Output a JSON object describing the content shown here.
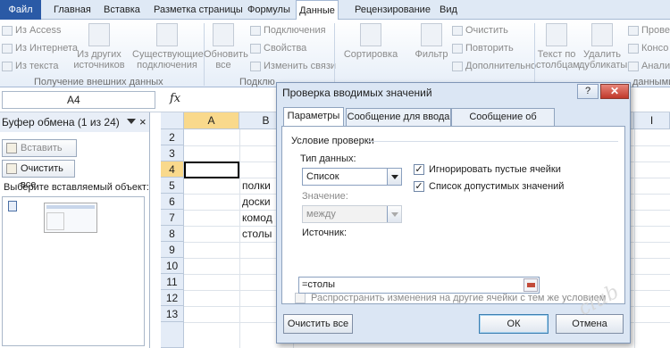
{
  "ribbon_tabs": [
    "Файл",
    "Главная",
    "Вставка",
    "Разметка страницы",
    "Формулы",
    "Данные",
    "Рецензирование",
    "Вид"
  ],
  "ribbon": {
    "ext_data": [
      "Из Access",
      "Из Интернета",
      "Из текста"
    ],
    "other_sources": "Из других источников",
    "existing_conn": "Существующие подключения",
    "ext_group_label": "Получение внешних данных",
    "refresh_all": "Обновить все",
    "conn_items": [
      "Подключения",
      "Свойства",
      "Изменить связи"
    ],
    "conn_group_label": "Подклю",
    "sort": "Сортировка",
    "filter": "Фильтр",
    "filter_items": [
      "Очистить",
      "Повторить",
      "Дополнительно"
    ],
    "text_to_cols": "Текст по столбцам",
    "remove_dup": "Удалить дубликаты",
    "right_items": [
      "Провер",
      "Консо",
      "Анализ"
    ],
    "right_group_label": "данными"
  },
  "formula_bar": {
    "name_box": "A4",
    "fx": "fx"
  },
  "clipboard": {
    "title": "Буфер обмена (1 из 24)",
    "close": "×",
    "paste_all": "Вставить все",
    "clear_all": "Очистить все",
    "choose_label": "Выберите вставляемый объект:"
  },
  "grid": {
    "columns": [
      "A",
      "B",
      "I"
    ],
    "rows": [
      "2",
      "3",
      "4",
      "5",
      "6",
      "7",
      "8",
      "9",
      "10",
      "11",
      "12",
      "13"
    ],
    "cells_b": [
      "",
      "",
      "",
      "полки",
      "доски",
      "комод",
      "столы"
    ]
  },
  "dialog": {
    "title": "Проверка вводимых значений",
    "help": "?",
    "close": "✕",
    "tabs": [
      "Параметры",
      "Сообщение для ввода",
      "Сообщение об ошибке"
    ],
    "condition_heading": "Условие проверки",
    "data_type_label": "Тип данных:",
    "data_type_value": "Список",
    "ignore_blank": "Игнорировать пустые ячейки",
    "in_cell_dropdown": "Список допустимых значений",
    "value_label": "Значение:",
    "value_value": "между",
    "source_label": "Источник:",
    "source_value": "=столы",
    "apply_all": "Распространить изменения на другие ячейки с тем же условием",
    "clear_all_btn": "Очистить все",
    "ok_btn": "ОК",
    "cancel_btn": "Отмена"
  },
  "colors": {
    "file_tab": "#2a5aa6",
    "selected_header": "#f9d98c",
    "dialog_bg": "#dbe6f4",
    "close_red": "#c0392b"
  }
}
